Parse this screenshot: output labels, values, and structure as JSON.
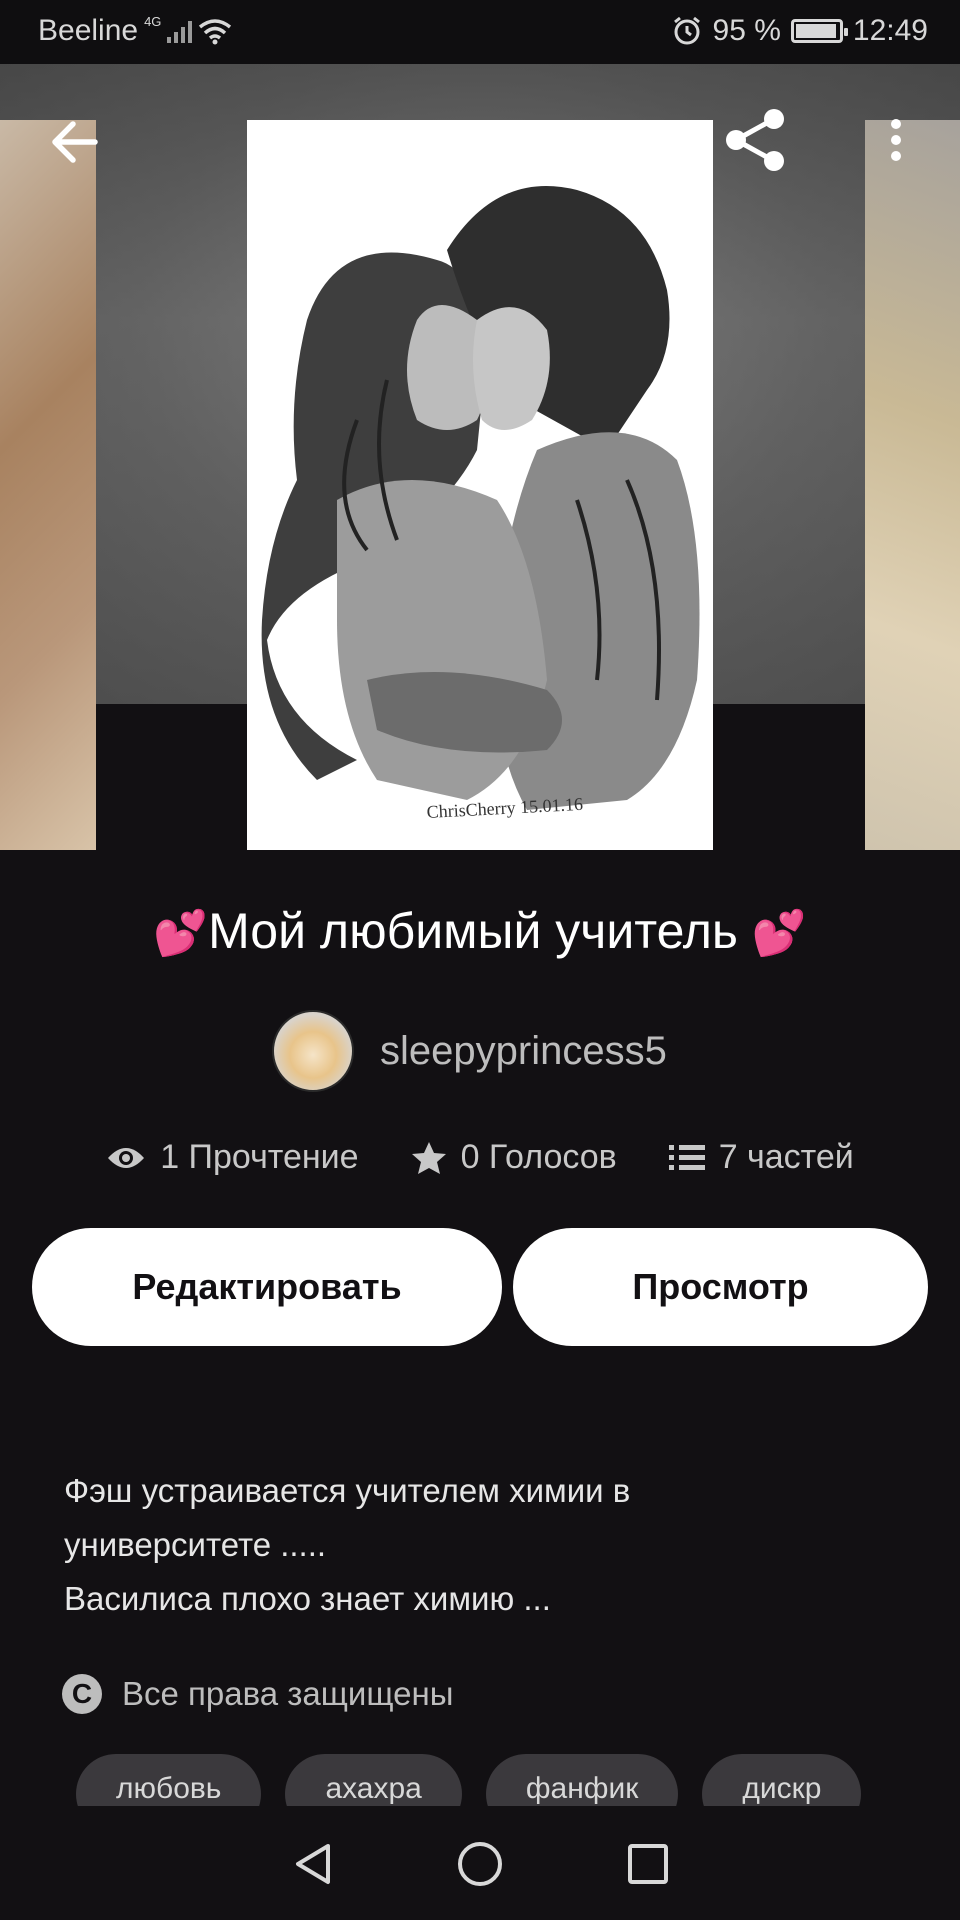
{
  "status_bar": {
    "carrier": "Beeline",
    "network": "4G",
    "battery": "95 %",
    "time": "12:49"
  },
  "header": {
    "icons": [
      "back-arrow-icon",
      "share-icon",
      "more-vertical-icon"
    ]
  },
  "story": {
    "title": "Мой любимый учитель",
    "title_prefix_emoji": "💕",
    "title_suffix_emoji": "💕",
    "author": "sleepyprincess5",
    "cover_signature": "ChrisCherry 15.01.16",
    "stats": {
      "reads": "1 Прочтение",
      "votes": "0 Голосов",
      "parts": "7 частей"
    },
    "description": [
      "Фэш устраивается учителем химии в",
      "университете .....",
      "Василиса плохо знает химию ..."
    ],
    "copyright": "Все права защищены",
    "tags": [
      "любовь",
      "ахахра",
      "фанфик",
      "дискр"
    ]
  },
  "actions": {
    "edit_label": "Редактировать",
    "view_label": "Просмотр"
  },
  "colors": {
    "background": "#121013",
    "button_bg": "#ffffff",
    "heart": "#e3302f",
    "muted_text": "#bdbdbd"
  }
}
